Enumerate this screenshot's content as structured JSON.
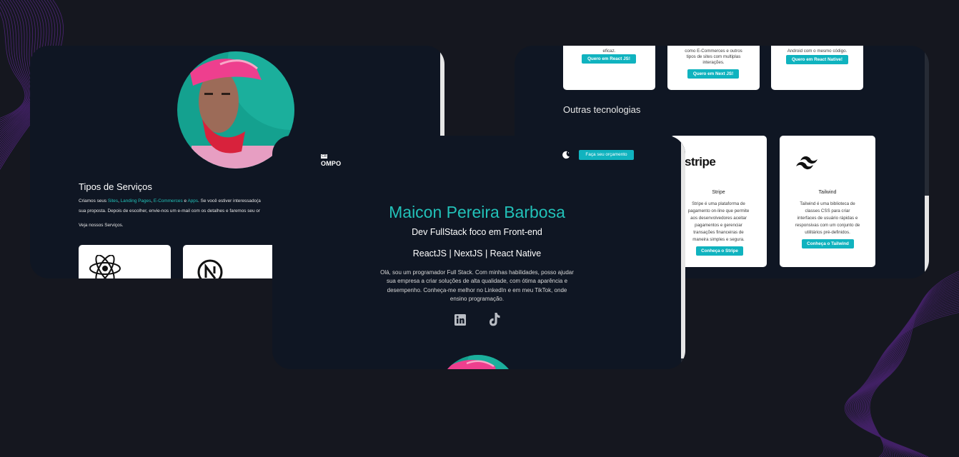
{
  "colors": {
    "background": "#15171f",
    "panel": "#0f1623",
    "accent": "#22c1b8",
    "button": "#10b3bf",
    "wave_lines": "#7b2fbf"
  },
  "left_panel": {
    "services_title": "Tipos de Serviços",
    "intro": {
      "prefix": "Criamos seus ",
      "sites": "Sites",
      "comma1": ", ",
      "landing": "Landing Pages",
      "comma2": ", ",
      "ecommerce": "E-Commerces",
      "and": " e ",
      "apps": "Apps",
      "suffix": ". Se você estiver interessado(a",
      "line2": "sua proposta. Depois de escolher, envie-nos um e-mail com os detalhes e faremos seu or"
    },
    "see_services": "Veja nossos Serviços.",
    "card_icons": [
      "react-icon",
      "nextjs-icon"
    ]
  },
  "right_panel": {
    "service_cards": [
      {
        "text": [
          "eficaz."
        ],
        "button": "Quero em React JS!"
      },
      {
        "text": [
          "como E-Commerces e outros",
          "tipos de sites com multiplas",
          "interações."
        ],
        "button": "Quero em Next JS!"
      },
      {
        "text": [
          "Android com o mesmo código."
        ],
        "button": "Quero em React Native!"
      }
    ],
    "other_tech_title": "Outras tecnologias",
    "tech_cards": [
      {
        "logo": "stripe",
        "name": "Stripe",
        "text": [
          "Stripe é uma plataforma de",
          "pagamento on-line que permite",
          "aos desenvolvedores aceitar",
          "pagamentos e gerenciar",
          "transações financeiras de",
          "maneira simples e segura."
        ],
        "button": "Conheça o Stripe"
      },
      {
        "logo": "tailwind-icon",
        "name": "Tailwind",
        "text": [
          "Tailwind é uma biblioteca de",
          "classes CSS para criar",
          "interfaces de usuário rápidas e",
          "responsivas com um conjunto de",
          "utilitários pré-definidos."
        ],
        "button": "Conheça o Tailwind"
      }
    ]
  },
  "center_panel": {
    "logo_small": "CR",
    "logo_text": "OMPO",
    "quote_button": "Faça seu orçamento",
    "name": "Maicon Pereira Barbosa",
    "role": "Dev FullStack foco em Front-end",
    "stack": "ReactJS | NextJS | React Native",
    "bio": "Olá, sou um programador Full Stack. Com minhas habilidades, posso ajudar sua empresa a criar soluções de alta qualidade, com ótima aparência e desempenho. Conheça-me melhor no LinkedIn e em meu TikTok, onde ensino programação.",
    "socials": [
      "linkedin-icon",
      "tiktok-icon"
    ]
  }
}
